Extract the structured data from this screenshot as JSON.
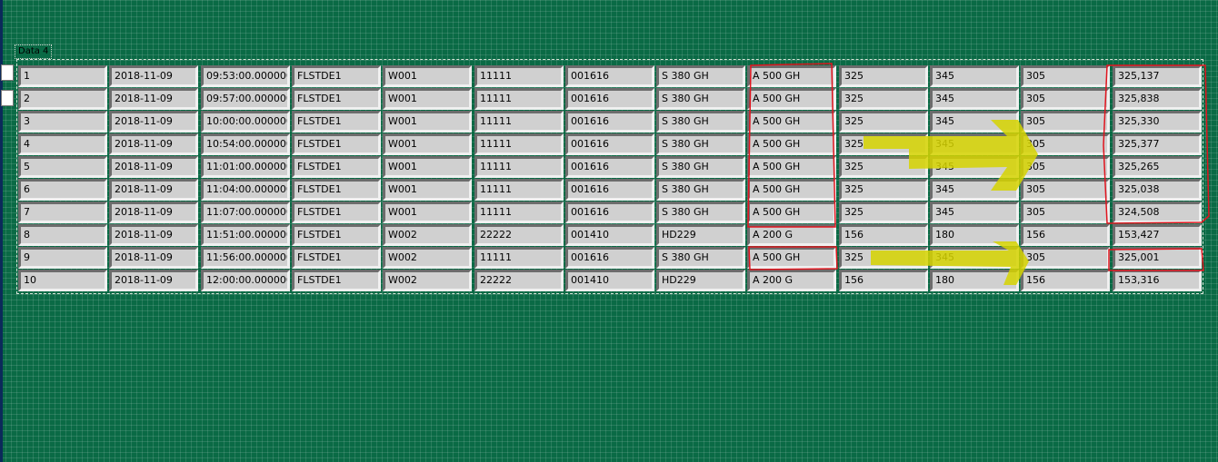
{
  "array_label": "Data 4",
  "rows": [
    [
      "1",
      "2018-11-09",
      "09:53:00.0000000",
      "FLSTDE1",
      "W001",
      "11111",
      "001616",
      "S 380 GH",
      "A 500 GH",
      "325",
      "345",
      "305",
      "325,137"
    ],
    [
      "2",
      "2018-11-09",
      "09:57:00.0000000",
      "FLSTDE1",
      "W001",
      "11111",
      "001616",
      "S 380 GH",
      "A 500 GH",
      "325",
      "345",
      "305",
      "325,838"
    ],
    [
      "3",
      "2018-11-09",
      "10:00:00.0000000",
      "FLSTDE1",
      "W001",
      "11111",
      "001616",
      "S 380 GH",
      "A 500 GH",
      "325",
      "345",
      "305",
      "325,330"
    ],
    [
      "4",
      "2018-11-09",
      "10:54:00.0000000",
      "FLSTDE1",
      "W001",
      "11111",
      "001616",
      "S 380 GH",
      "A 500 GH",
      "325",
      "345",
      "305",
      "325,377"
    ],
    [
      "5",
      "2018-11-09",
      "11:01:00.0000000",
      "FLSTDE1",
      "W001",
      "11111",
      "001616",
      "S 380 GH",
      "A 500 GH",
      "325",
      "345",
      "305",
      "325,265"
    ],
    [
      "6",
      "2018-11-09",
      "11:04:00.0000000",
      "FLSTDE1",
      "W001",
      "11111",
      "001616",
      "S 380 GH",
      "A 500 GH",
      "325",
      "345",
      "305",
      "325,038"
    ],
    [
      "7",
      "2018-11-09",
      "11:07:00.0000000",
      "FLSTDE1",
      "W001",
      "11111",
      "001616",
      "S 380 GH",
      "A 500 GH",
      "325",
      "345",
      "305",
      "324,508"
    ],
    [
      "8",
      "2018-11-09",
      "11:51:00.0000000",
      "FLSTDE1",
      "W002",
      "22222",
      "001410",
      "HD229",
      "A 200 G",
      "156",
      "180",
      "156",
      "153,427"
    ],
    [
      "9",
      "2018-11-09",
      "11:56:00.0000000",
      "FLSTDE1",
      "W002",
      "11111",
      "001616",
      "S 380 GH",
      "A 500 GH",
      "325",
      "345",
      "305",
      "325,001"
    ],
    [
      "10",
      "2018-11-09",
      "12:00:00.0000000",
      "FLSTDE1",
      "W002",
      "22222",
      "001410",
      "HD229",
      "A 200 G",
      "156",
      "180",
      "156",
      "153,316"
    ]
  ],
  "colors": {
    "background": "#0a6a45",
    "cell": "#d0d0d0",
    "annotation_red": "#e0141e",
    "annotation_yellow": "#d6d400"
  }
}
